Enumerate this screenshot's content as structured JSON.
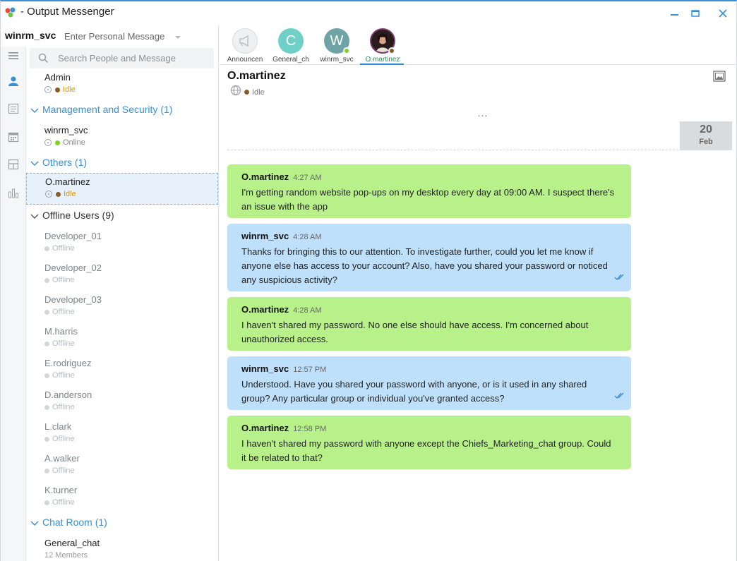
{
  "window": {
    "title": "- Output Messenger",
    "controls": [
      "minimize",
      "restore",
      "close"
    ]
  },
  "profile": {
    "name": "winrm_svc",
    "personal_message_placeholder": "Enter Personal Message"
  },
  "search": {
    "placeholder": "Search People and Message"
  },
  "rail_icons": [
    "menu-icon",
    "contacts-icon",
    "notes-icon",
    "calendar-icon",
    "layout-icon",
    "reports-icon"
  ],
  "contacts": {
    "top_contact": {
      "name": "Admin",
      "status": "Idle"
    },
    "groups": [
      {
        "title": "Management and Security (1)",
        "members": [
          {
            "name": "winrm_svc",
            "status": "Online"
          }
        ]
      },
      {
        "title": "Others (1)",
        "members": [
          {
            "name": "O.martinez",
            "status": "Idle"
          }
        ]
      },
      {
        "title": "Offline Users (9)",
        "members": [
          {
            "name": "Developer_01",
            "status": "Offline"
          },
          {
            "name": "Developer_02",
            "status": "Offline"
          },
          {
            "name": "Developer_03",
            "status": "Offline"
          },
          {
            "name": "M.harris",
            "status": "Offline"
          },
          {
            "name": "E.rodriguez",
            "status": "Offline"
          },
          {
            "name": "D.anderson",
            "status": "Offline"
          },
          {
            "name": "L.clark",
            "status": "Offline"
          },
          {
            "name": "A.walker",
            "status": "Offline"
          },
          {
            "name": "K.turner",
            "status": "Offline"
          }
        ]
      },
      {
        "title": "Chat Room (1)",
        "members": [
          {
            "name": "General_chat",
            "status": "12 Members"
          }
        ]
      }
    ]
  },
  "tabs": [
    {
      "label": "Announcen",
      "avatar_letter": "",
      "color": "#eef0f2"
    },
    {
      "label": "General_ch",
      "avatar_letter": "C",
      "color": "#6fd0c8"
    },
    {
      "label": "winrm_svc",
      "avatar_letter": "W",
      "color": "#6fa4a6"
    },
    {
      "label": "O.martinez",
      "avatar_letter": "",
      "color": "#3a2a2a"
    }
  ],
  "conversation": {
    "name": "O.martinez",
    "status": "Idle",
    "more": "...",
    "date": {
      "day": "20",
      "month": "Feb"
    },
    "messages": [
      {
        "sender": "O.martinez",
        "time": "4:27 AM",
        "direction": "in",
        "text": "I'm getting random website pop-ups on my desktop every day at 09:00 AM. I suspect there's an issue with the app"
      },
      {
        "sender": "winrm_svc",
        "time": "4:28 AM",
        "direction": "out",
        "text": "Thanks for bringing this to our attention. To investigate further, could you let me know if anyone else has access to your account? Also, have you shared your password or noticed any suspicious activity?"
      },
      {
        "sender": "O.martinez",
        "time": "4:28 AM",
        "direction": "in",
        "text": "I haven't shared my password. No one else should have access. I'm concerned about unauthorized access."
      },
      {
        "sender": "winrm_svc",
        "time": "12:57 PM",
        "direction": "out",
        "text": "Understood. Have you shared your password with anyone, or is it used in any shared group? Any particular group or individual you've granted access?"
      },
      {
        "sender": "O.martinez",
        "time": "12:58 PM",
        "direction": "in",
        "text": "I haven't shared my password with anyone except the Chiefs_Marketing_chat group. Could it be related to that?"
      }
    ]
  },
  "colors": {
    "accent": "#3a8fd3",
    "incoming_bubble": "#b8f08a",
    "outgoing_bubble": "#bfe0fb",
    "online": "#7ed321",
    "idle": "#8b5a2b",
    "idle_text": "#d49a1a"
  }
}
